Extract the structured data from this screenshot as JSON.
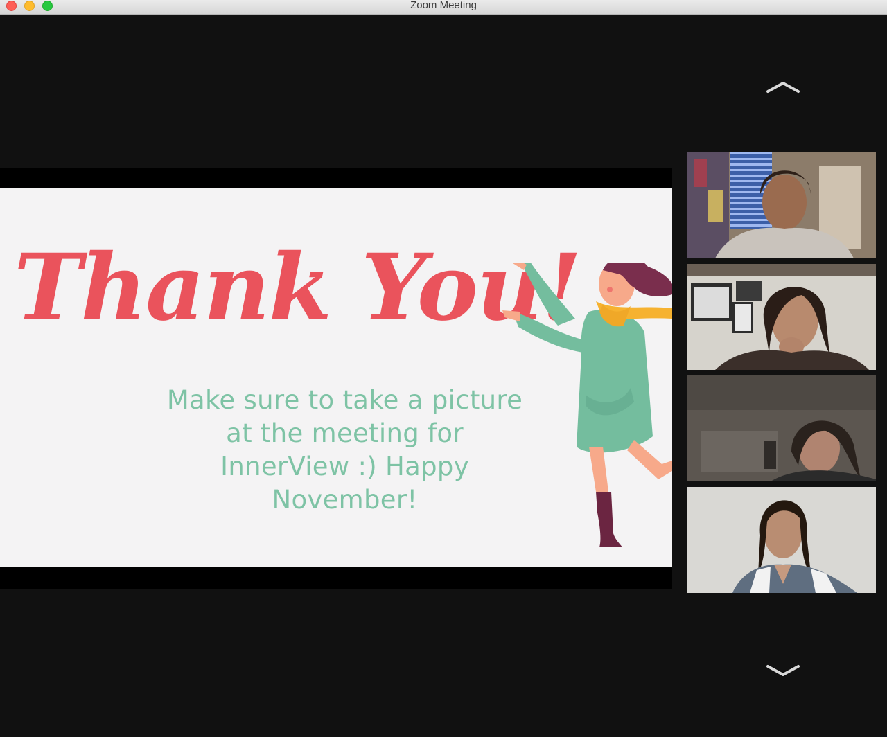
{
  "window": {
    "title": "Zoom Meeting"
  },
  "slide": {
    "title": "Thank You!",
    "body_lines": [
      "Make sure to take a picture",
      "at the meeting for",
      "InnerView :) Happy",
      "November!"
    ]
  },
  "gallery": {
    "scroll_up_icon": "chevron-up-icon",
    "scroll_down_icon": "chevron-down-icon",
    "participant_count": 4
  },
  "colors": {
    "slide_title": "#ea535c",
    "slide_body": "#7ec3a5",
    "background": "#111111"
  }
}
